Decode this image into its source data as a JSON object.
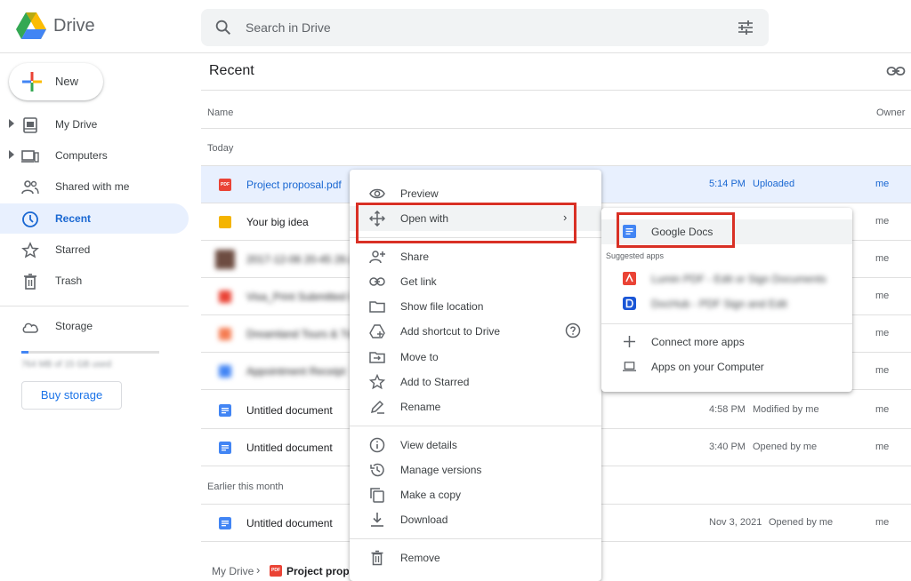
{
  "header": {
    "brand": "Drive",
    "search_placeholder": "Search in Drive"
  },
  "sidebar": {
    "new_label": "New",
    "items": [
      {
        "label": "My Drive"
      },
      {
        "label": "Computers"
      },
      {
        "label": "Shared with me"
      },
      {
        "label": "Recent"
      },
      {
        "label": "Starred"
      },
      {
        "label": "Trash"
      }
    ],
    "storage_label": "Storage",
    "storage_text": "764 MB of 15 GB used",
    "storage_used_fraction": 0.05,
    "buy_storage": "Buy storage"
  },
  "main": {
    "title": "Recent",
    "col_name": "Name",
    "col_owner": "Owner",
    "section_today": "Today",
    "section_earlier": "Earlier this month",
    "rows": [
      {
        "name": "Project proposal.pdf",
        "date": "5:14 PM",
        "activity": "Uploaded",
        "owner": "me"
      },
      {
        "name": "Your big idea",
        "date": "",
        "activity": "",
        "owner": "me"
      },
      {
        "name": "2017-12-06 20-45 26-2",
        "date": "",
        "activity": "",
        "owner": "me"
      },
      {
        "name": "Visa_Print Submitted I",
        "date": "",
        "activity": "",
        "owner": "me"
      },
      {
        "name": "Dreamland Tours & Tra",
        "date": "",
        "activity": "",
        "owner": "me"
      },
      {
        "name": "Appointment Receipt",
        "date": "",
        "activity": "",
        "owner": "me"
      },
      {
        "name": "Untitled document",
        "date": "4:58 PM",
        "activity": "Modified by me",
        "owner": "me"
      },
      {
        "name": "Untitled document",
        "date": "3:40 PM",
        "activity": "Opened by me",
        "owner": "me"
      },
      {
        "name": "Untitled document",
        "date": "Nov 3, 2021",
        "activity": "Opened by me",
        "owner": "me"
      }
    ],
    "breadcrumb": {
      "root": "My Drive",
      "current": "Project proposal.pdf",
      "pdf_badge": "PDF"
    }
  },
  "context_menu": {
    "items": [
      {
        "label": "Preview"
      },
      {
        "label": "Open with"
      },
      {
        "label": "Share"
      },
      {
        "label": "Get link"
      },
      {
        "label": "Show file location"
      },
      {
        "label": "Add shortcut to Drive"
      },
      {
        "label": "Move to"
      },
      {
        "label": "Add to Starred"
      },
      {
        "label": "Rename"
      },
      {
        "label": "View details"
      },
      {
        "label": "Manage versions"
      },
      {
        "label": "Make a copy"
      },
      {
        "label": "Download"
      },
      {
        "label": "Remove"
      }
    ],
    "chevron": "›"
  },
  "submenu": {
    "primary": "Google Docs",
    "suggested_label": "Suggested apps",
    "suggested": [
      {
        "label": "Lumin PDF - Edit or Sign Documents"
      },
      {
        "label": "DocHub - PDF Sign and Edit"
      }
    ],
    "connect": "Connect more apps",
    "computer": "Apps on your Computer"
  },
  "colors": {
    "accent": "#1a73e8",
    "selected_bg": "#e8f0fe",
    "highlight_box": "#d93025",
    "pdf_red": "#ea4335",
    "docs_blue": "#4285f4",
    "slides_yellow": "#f4b400"
  }
}
